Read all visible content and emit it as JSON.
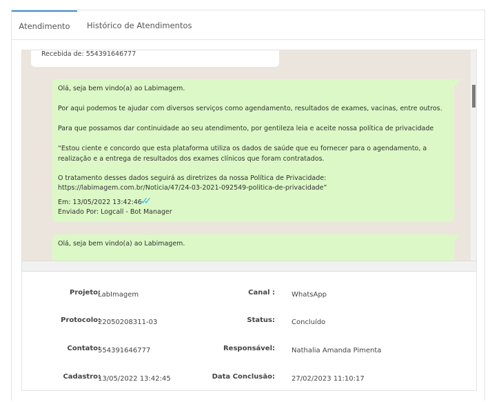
{
  "tabs": [
    {
      "label": "Atendimento",
      "active": true
    },
    {
      "label": "Histórico de Atendimentos",
      "active": false
    }
  ],
  "chat": {
    "incoming": {
      "text": "Recebida de: 554391646777"
    },
    "outgoing": [
      {
        "lines": [
          " Olá, seja bem vindo(a) ao Labimagem.",
          "Por aqui podemos te ajudar com diversos serviços como agendamento, resultados de exames, vacinas, entre outros.",
          "Para que possamos dar continuidade ao seu atendimento, por gentileza leia e aceite nossa política de privacidade",
          "“Estou ciente e concordo que esta plataforma utiliza os dados de saúde que eu fornecer para o agendamento, a",
          "realização e a entrega de resultados dos exames clínicos que foram contratados.",
          "O tratamento desses dados seguirá as diretrizes da nossa Política de Privacidade:",
          "https://labimagem.com.br/Noticia/47/24-03-2021-092549-politica-de-privacidade”"
        ],
        "timestamp": "Em: 13/05/2022 13:42:46",
        "sender": "Enviado Por: Logcall - Bot Manager"
      },
      {
        "lines": [
          " Olá, seja bem vindo(a) ao Labimagem."
        ]
      }
    ],
    "colors": {
      "background": "#ece5dd",
      "outgoing_bubble": "#dcf8c6",
      "incoming_bubble": "#ffffff",
      "read_ticks": "#34b7f1"
    }
  },
  "details": {
    "projeto_label": "Projeto:",
    "projeto_value": "LabImagem",
    "canal_label": "Canal :",
    "canal_value": "WhatsApp",
    "protocolo_label": "Protocolo:",
    "protocolo_value": "22050208311-03",
    "status_label": "Status:",
    "status_value": "Concluído",
    "contato_label": "Contato:",
    "contato_value": "554391646777",
    "responsavel_label": "Responsável:",
    "responsavel_value": "Nathalia Amanda Pimenta",
    "cadastro_label": "Cadastro:",
    "cadastro_value": "13/05/2022 13:42:45",
    "conclusao_label": "Data Conclusão:",
    "conclusao_value": "27/02/2023 11:10:17"
  }
}
